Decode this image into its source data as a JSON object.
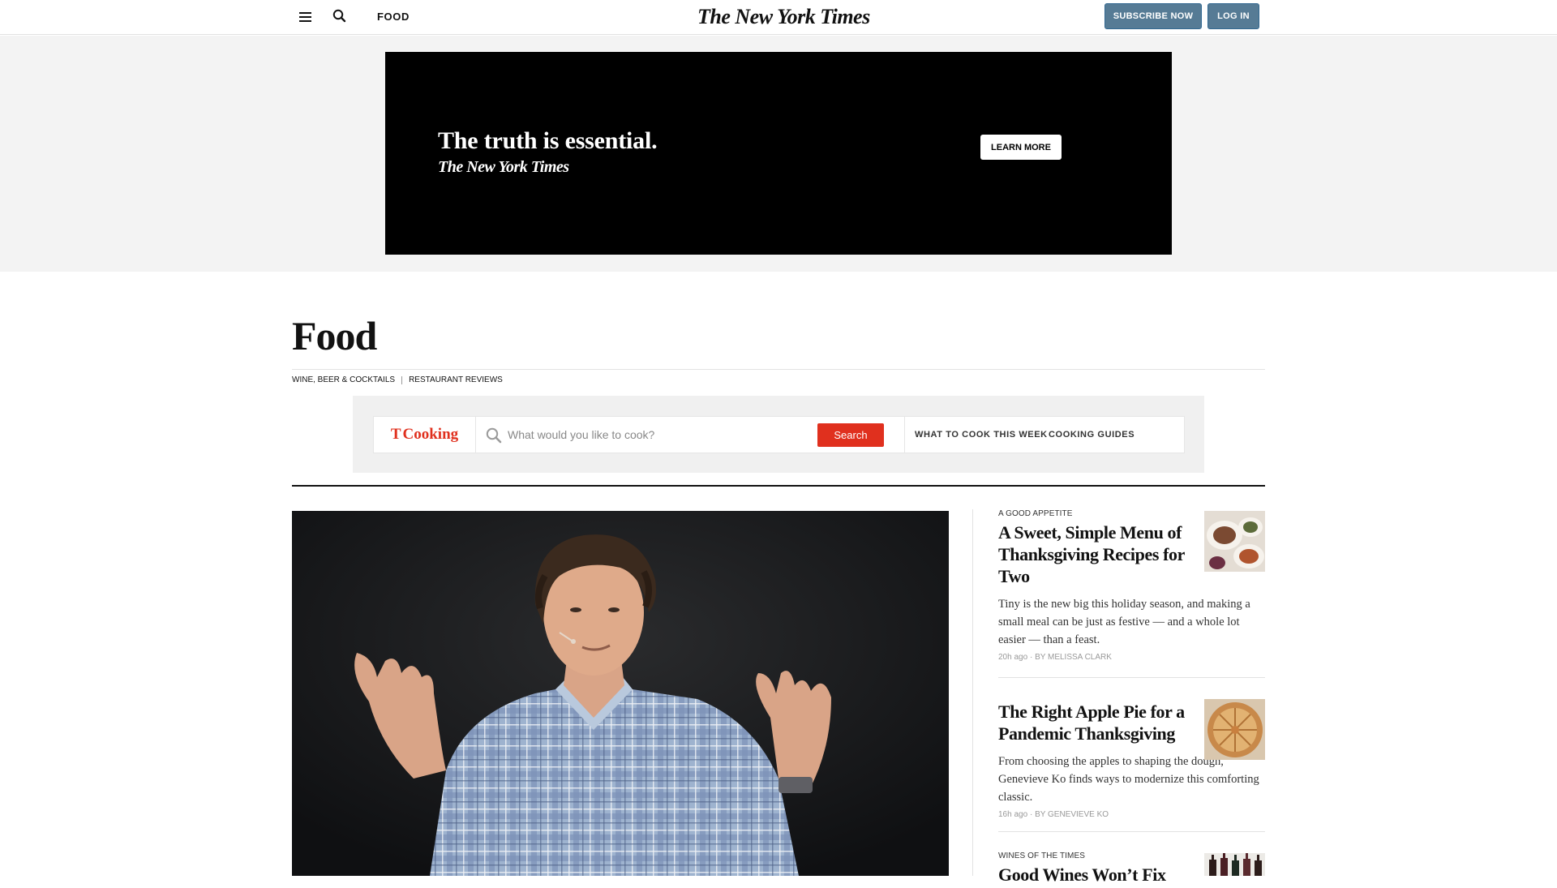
{
  "header": {
    "section": "FOOD",
    "logo": "The New York Times",
    "subscribe": "SUBSCRIBE NOW",
    "login": "LOG IN"
  },
  "ad": {
    "headline": "The truth is essential.",
    "logo": "The New York Times",
    "button": "LEARN MORE"
  },
  "section": {
    "title": "Food",
    "subnav": [
      "WINE, BEER & COCKTAILS",
      "RESTAURANT REVIEWS"
    ]
  },
  "cooking": {
    "logo_mark": "T",
    "logo_word": "Cooking",
    "placeholder": "What would you like to cook?",
    "search_button": "Search",
    "links": [
      "WHAT TO COOK THIS WEEK",
      "COOKING GUIDES"
    ]
  },
  "stories": [
    {
      "kicker": "A GOOD APPETITE",
      "headline": "A Sweet, Simple Menu of Thanksgiving Recipes for Two",
      "summary": "Tiny is the new big this holiday season, and making a small meal can be just as festive — and a whole lot easier — than a feast.",
      "ago": "20h ago",
      "byline": "By MELISSA CLARK"
    },
    {
      "kicker": "",
      "headline": "The Right Apple Pie for a Pandemic Thanksgiving",
      "summary": "From choosing the apples to shaping the dough, Genevieve Ko finds ways to modernize this comforting classic.",
      "ago": "16h ago",
      "byline": "By GENEVIEVE KO"
    },
    {
      "kicker": "WINES OF THE TIMES",
      "headline": "Good Wines Won’t Fix"
    }
  ],
  "colors": {
    "cooking_red": "#e0301e",
    "header_button": "#567b95"
  }
}
